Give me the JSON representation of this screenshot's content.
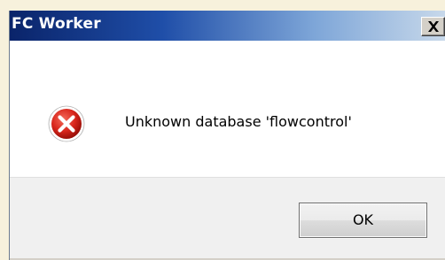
{
  "dialog": {
    "title": "FC Worker",
    "message": "Unknown database 'flowcontrol'",
    "icon": "error-icon",
    "ok_label": "OK",
    "close_icon": "close-icon"
  },
  "colors": {
    "titlebar_start": "#0a246a",
    "titlebar_end": "#c7d8ea",
    "error_red": "#d9261c",
    "background": "#f7f1dc"
  }
}
